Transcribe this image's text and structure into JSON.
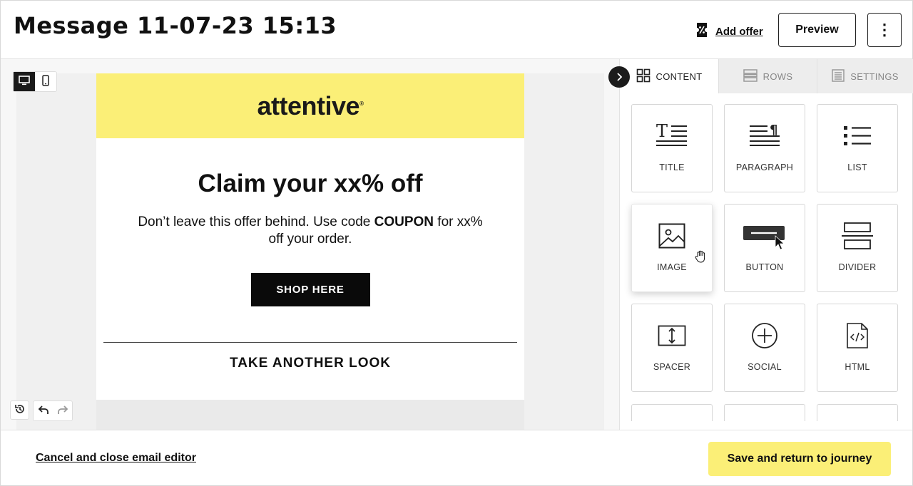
{
  "header": {
    "title": "Message 11-07-23 15:13",
    "add_offer_label": "Add offer",
    "preview_label": "Preview",
    "more_label": "⋮"
  },
  "email": {
    "logo": "attentive",
    "logo_mark": "®",
    "headline": "Claim your xx% off",
    "body_prefix": "Don’t leave this offer behind. Use code ",
    "body_code": "COUPON",
    "body_suffix": " for xx% off your order.",
    "cta_label": "SHOP HERE",
    "section_title": "TAKE ANOTHER LOOK",
    "header_bg": "#fbef77"
  },
  "panel": {
    "tabs": [
      {
        "label": "CONTENT",
        "icon": "grid-icon",
        "active": true
      },
      {
        "label": "ROWS",
        "icon": "rows-icon",
        "active": false
      },
      {
        "label": "SETTINGS",
        "icon": "settings-list-icon",
        "active": false
      }
    ],
    "tiles": [
      {
        "label": "TITLE",
        "icon": "title-icon"
      },
      {
        "label": "PARAGRAPH",
        "icon": "paragraph-icon"
      },
      {
        "label": "LIST",
        "icon": "list-icon"
      },
      {
        "label": "IMAGE",
        "icon": "image-icon"
      },
      {
        "label": "BUTTON",
        "icon": "button-icon"
      },
      {
        "label": "DIVIDER",
        "icon": "divider-icon"
      },
      {
        "label": "SPACER",
        "icon": "spacer-icon"
      },
      {
        "label": "SOCIAL",
        "icon": "social-icon"
      },
      {
        "label": "HTML",
        "icon": "html-icon"
      }
    ]
  },
  "footer": {
    "cancel_label": "Cancel and close email editor",
    "save_label": "Save and return to journey",
    "accent": "#fbef77"
  }
}
